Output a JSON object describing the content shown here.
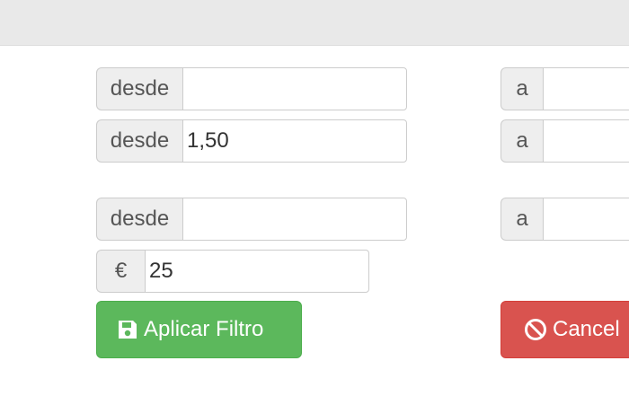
{
  "filters": {
    "row1": {
      "from_label": "desde",
      "from_value": "",
      "to_label": "a",
      "to_value": ""
    },
    "row2": {
      "from_label": "desde",
      "from_value": "1,50",
      "to_label": "a",
      "to_value": ""
    },
    "row3": {
      "from_label": "desde",
      "from_value": "",
      "to_label": "a",
      "to_value": ""
    },
    "price": {
      "currency_symbol": "€",
      "value": "25"
    }
  },
  "buttons": {
    "apply_label": "Aplicar Filtro",
    "apply_icon": "save-icon",
    "cancel_label": "Cancel",
    "cancel_icon": "ban-icon"
  },
  "colors": {
    "success": "#5cb85c",
    "danger": "#d9534f",
    "addon_bg": "#eeeeee"
  }
}
